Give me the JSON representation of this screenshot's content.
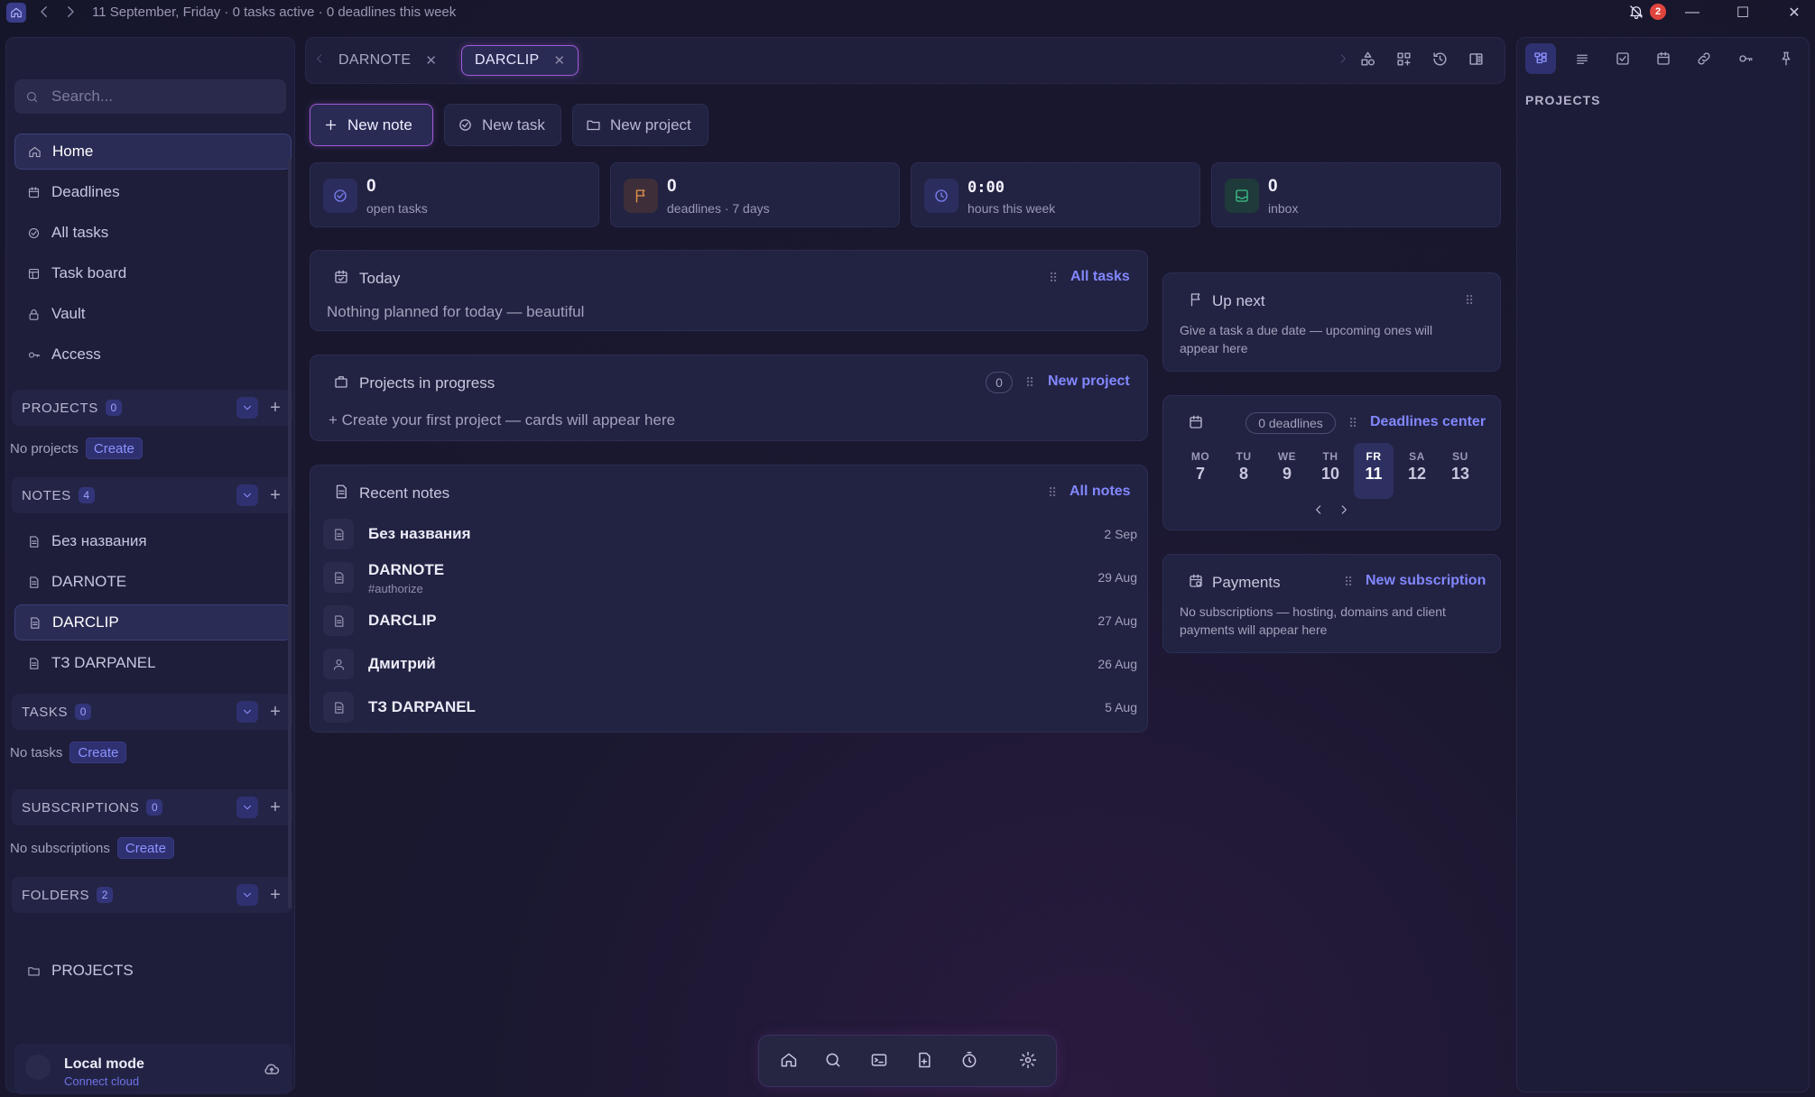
{
  "titlebar": {
    "status": "11 September, Friday · 0 tasks active · 0 deadlines this week",
    "notification_count": "2"
  },
  "sidebar": {
    "search_placeholder": "Search...",
    "nav": [
      {
        "label": "Home",
        "icon": "home-icon",
        "active": true
      },
      {
        "label": "Deadlines",
        "icon": "calendar-icon"
      },
      {
        "label": "All tasks",
        "icon": "check-circle-icon"
      },
      {
        "label": "Task board",
        "icon": "board-icon"
      },
      {
        "label": "Vault",
        "icon": "lock-icon"
      },
      {
        "label": "Access",
        "icon": "key-icon"
      }
    ],
    "projects": {
      "title": "PROJECTS",
      "count": "0",
      "empty": "No projects",
      "create": "Create"
    },
    "notes": {
      "title": "NOTES",
      "count": "4",
      "items": [
        {
          "label": "Без названия"
        },
        {
          "label": "DARNOTE"
        },
        {
          "label": "DARCLIP",
          "active": true
        },
        {
          "label": "ТЗ DARPANEL"
        }
      ]
    },
    "tasks": {
      "title": "TASKS",
      "count": "0",
      "empty": "No tasks",
      "create": "Create"
    },
    "subscriptions": {
      "title": "SUBSCRIPTIONS",
      "count": "0",
      "empty": "No subscriptions",
      "create": "Create"
    },
    "folders": {
      "title": "FOLDERS",
      "count": "2",
      "items": [
        {
          "label": "PROJECTS"
        }
      ]
    },
    "local": {
      "title": "Local mode",
      "subtitle": "Connect cloud"
    }
  },
  "tabs": [
    {
      "label": "DARNOTE",
      "active": false
    },
    {
      "label": "DARCLIP",
      "active": true
    }
  ],
  "actions": {
    "new_note": "New note",
    "new_task": "New task",
    "new_project": "New project"
  },
  "stats": [
    {
      "value": "0",
      "label": "open tasks",
      "color": "#6f73e8"
    },
    {
      "value": "0",
      "label": "deadlines · 7 days",
      "color": "#e8964a"
    },
    {
      "value": "0:00",
      "label": "hours this week",
      "color": "#6f73e8"
    },
    {
      "value": "0",
      "label": "inbox",
      "color": "#3cc08a"
    }
  ],
  "today": {
    "title": "Today",
    "link": "All tasks",
    "empty": "Nothing planned for today — beautiful"
  },
  "projects_card": {
    "title": "Projects in progress",
    "count": "0",
    "link": "New project",
    "empty": "+ Create your first project — cards will appear here"
  },
  "recent_notes": {
    "title": "Recent notes",
    "link": "All notes",
    "items": [
      {
        "title": "Без названия",
        "tag": "",
        "date": "2 Sep",
        "icon": "document-icon"
      },
      {
        "title": "DARNOTE",
        "tag": "#authorize",
        "date": "29 Aug",
        "icon": "document-icon"
      },
      {
        "title": "DARCLIP",
        "tag": "",
        "date": "27 Aug",
        "icon": "document-icon"
      },
      {
        "title": "Дмитрий",
        "tag": "",
        "date": "26 Aug",
        "icon": "person-icon"
      },
      {
        "title": "ТЗ DARPANEL",
        "tag": "",
        "date": "5 Aug",
        "icon": "document-icon"
      }
    ]
  },
  "up_next": {
    "title": "Up next",
    "text_line1": "Give a task a due date — upcoming ones will",
    "text_line2": "appear here"
  },
  "deadlines": {
    "pill": "0 deadlines",
    "link": "Deadlines center",
    "days": [
      {
        "name": "MO",
        "num": "7"
      },
      {
        "name": "TU",
        "num": "8"
      },
      {
        "name": "WE",
        "num": "9"
      },
      {
        "name": "TH",
        "num": "10"
      },
      {
        "name": "FR",
        "num": "11",
        "today": true
      },
      {
        "name": "SA",
        "num": "12"
      },
      {
        "name": "SU",
        "num": "13"
      }
    ]
  },
  "payments": {
    "title": "Payments",
    "link": "New subscription",
    "text_line1": "No subscriptions — hosting, domains and client",
    "text_line2": "payments will appear here"
  },
  "right_panel": {
    "title": "PROJECTS"
  }
}
